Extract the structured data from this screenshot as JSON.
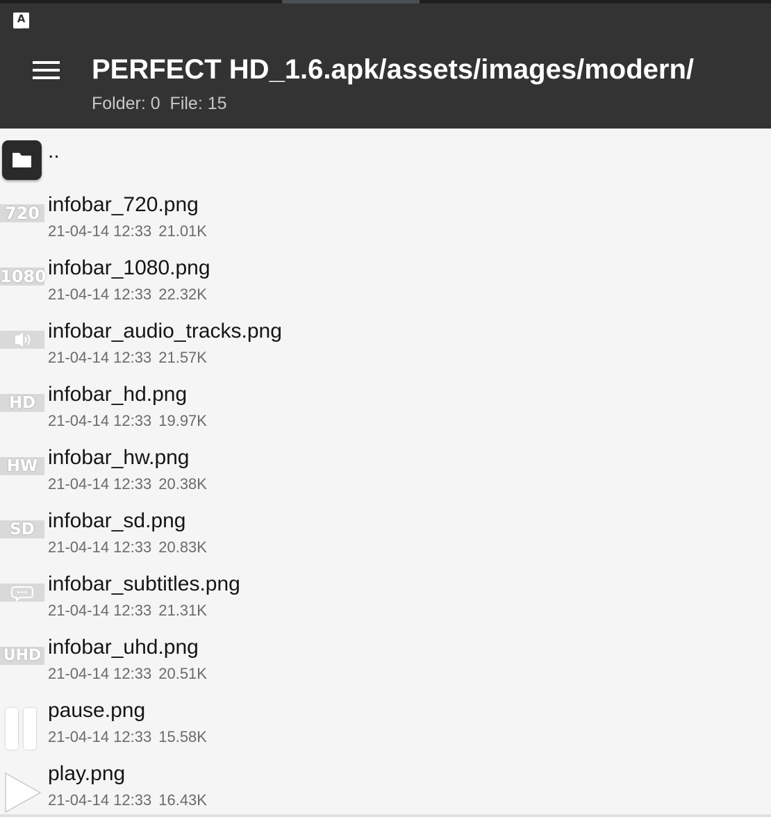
{
  "statusbar": {
    "app_icon_letter": "A"
  },
  "appbar": {
    "title": "PERFECT HD_1.6.apk/assets/images/modern/",
    "subtitle": "Folder: 0  File: 15",
    "menu_icon": "hamburger-menu-icon"
  },
  "list": {
    "parent": {
      "name": "..",
      "icon": "folder-icon"
    },
    "files": [
      {
        "name": "infobar_720.png",
        "date": "21-04-14 12:33",
        "size": "21.01K",
        "thumb_text": "720"
      },
      {
        "name": "infobar_1080.png",
        "date": "21-04-14 12:33",
        "size": "22.32K",
        "thumb_text": "1080"
      },
      {
        "name": "infobar_audio_tracks.png",
        "date": "21-04-14 12:33",
        "size": "21.57K",
        "thumb_icon": "speaker-icon"
      },
      {
        "name": "infobar_hd.png",
        "date": "21-04-14 12:33",
        "size": "19.97K",
        "thumb_text": "HD"
      },
      {
        "name": "infobar_hw.png",
        "date": "21-04-14 12:33",
        "size": "20.38K",
        "thumb_text": "HW"
      },
      {
        "name": "infobar_sd.png",
        "date": "21-04-14 12:33",
        "size": "20.83K",
        "thumb_text": "SD"
      },
      {
        "name": "infobar_subtitles.png",
        "date": "21-04-14 12:33",
        "size": "21.31K",
        "thumb_icon": "speech-bubble-icon"
      },
      {
        "name": "infobar_uhd.png",
        "date": "21-04-14 12:33",
        "size": "20.51K",
        "thumb_text": "UHD"
      },
      {
        "name": "pause.png",
        "date": "21-04-14 12:33",
        "size": "15.58K",
        "thumb_icon": "pause-icon"
      },
      {
        "name": "play.png",
        "date": "21-04-14 12:33",
        "size": "16.43K",
        "thumb_icon": "play-icon"
      }
    ]
  }
}
